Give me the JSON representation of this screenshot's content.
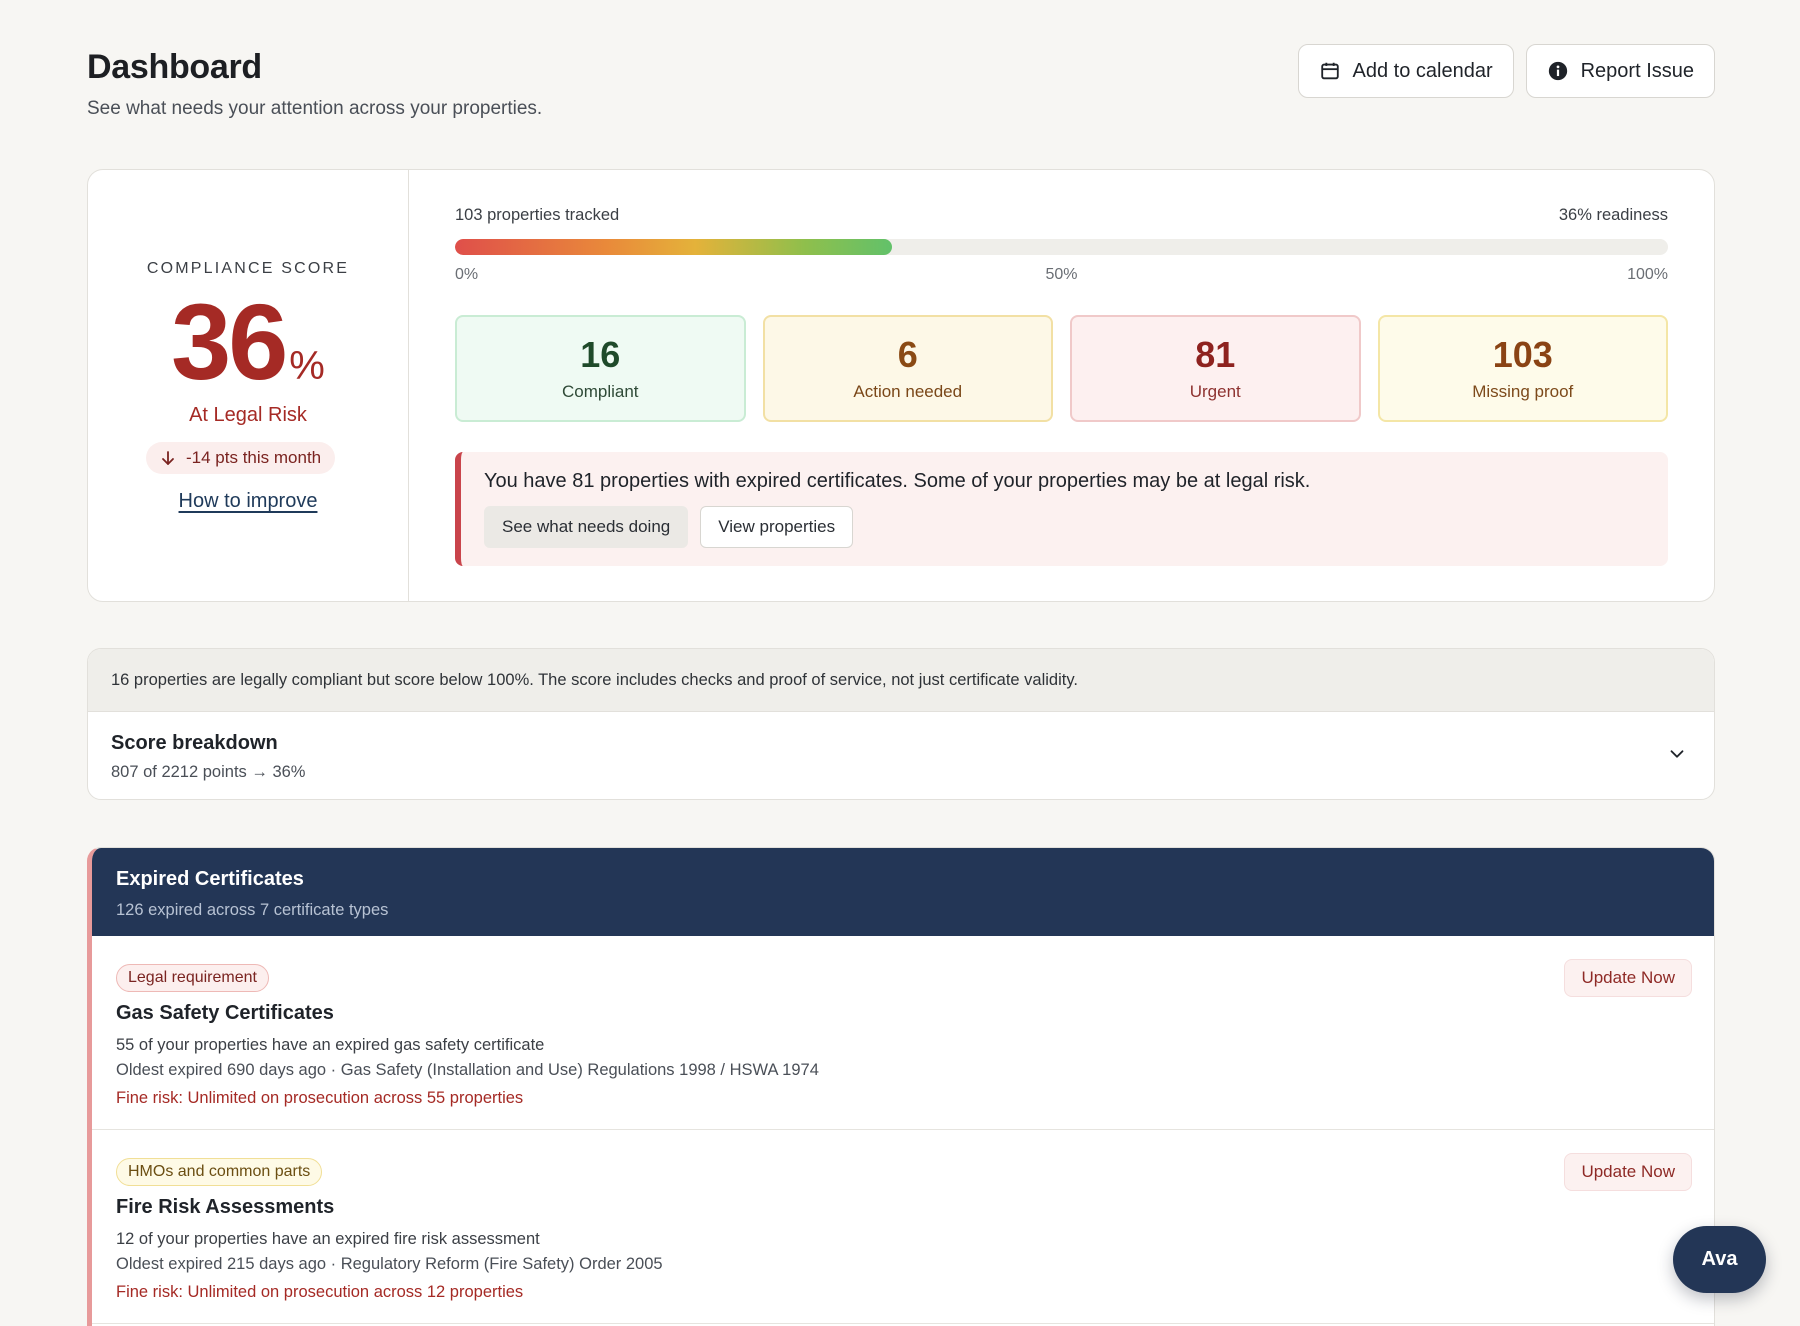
{
  "header": {
    "title": "Dashboard",
    "subtitle": "See what needs your attention across your properties.",
    "actions": {
      "calendar_label": "Add to calendar",
      "report_label": "Report Issue"
    }
  },
  "compliance": {
    "label": "COMPLIANCE SCORE",
    "score": "36",
    "score_unit": "%",
    "status": "At Legal Risk",
    "delta": "-14 pts this month",
    "improve_link": "How to improve",
    "tracked": "103 properties tracked",
    "readiness": "36% readiness",
    "readiness_fraction": 0.36,
    "ticks": [
      "0%",
      "50%",
      "100%"
    ],
    "stats": [
      {
        "value": "16",
        "label": "Compliant"
      },
      {
        "value": "6",
        "label": "Action needed"
      },
      {
        "value": "81",
        "label": "Urgent"
      },
      {
        "value": "103",
        "label": "Missing proof"
      }
    ],
    "alert": {
      "text": "You have 81 properties with expired certificates. Some of your properties may be at legal risk.",
      "primary_action": "See what needs doing",
      "secondary_action": "View properties"
    }
  },
  "info": {
    "banner": "16 properties are legally compliant but score below 100%. The score includes checks and proof of service, not just certificate validity.",
    "breakdown_title": "Score breakdown",
    "breakdown_sub": "807 of 2212 points → 36%"
  },
  "expired": {
    "title": "Expired Certificates",
    "subtitle": "126 expired across 7 certificate types",
    "items": [
      {
        "tag": "Legal requirement",
        "title": "Gas Safety Certificates",
        "description": "55 of your properties have an expired gas safety certificate",
        "meta": "Oldest expired 690 days ago · Gas Safety (Installation and Use) Regulations 1998 / HSWA 1974",
        "fine": "Fine risk: Unlimited on prosecution across 55 properties",
        "action": "Update Now"
      },
      {
        "tag": "HMOs and common parts",
        "title": "Fire Risk Assessments",
        "description": "12 of your properties have an expired fire risk assessment",
        "meta": "Oldest expired 215 days ago · Regulatory Reform (Fire Safety) Order 2005",
        "fine": "Fine risk: Unlimited on prosecution across 12 properties",
        "action": "Update Now"
      }
    ]
  },
  "assistant": {
    "label": "Ava"
  },
  "colors": {
    "accent_red": "#a52a25",
    "navy": "#233656",
    "background": "#f7f6f3"
  },
  "icons": [
    "calendar-icon",
    "info-icon",
    "arrow-down-icon",
    "chevron-down-icon"
  ]
}
